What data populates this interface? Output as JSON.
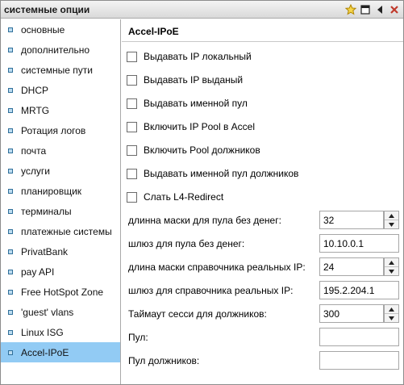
{
  "window": {
    "title": "системные опции"
  },
  "sidebar": {
    "items": [
      {
        "label": "основные"
      },
      {
        "label": "дополнительно"
      },
      {
        "label": "системные пути"
      },
      {
        "label": "DHCP"
      },
      {
        "label": "MRTG"
      },
      {
        "label": "Ротация логов"
      },
      {
        "label": "почта"
      },
      {
        "label": "услуги"
      },
      {
        "label": "планировщик"
      },
      {
        "label": "терминалы"
      },
      {
        "label": "платежные системы"
      },
      {
        "label": "PrivatBank"
      },
      {
        "label": "pay API"
      },
      {
        "label": "Free HotSpot Zone"
      },
      {
        "label": "'guest' vlans"
      },
      {
        "label": "Linux ISG"
      },
      {
        "label": "Accel-IPoE"
      }
    ],
    "active_index": 16
  },
  "main": {
    "heading": "Accel-IPoE",
    "checkboxes": [
      {
        "label": "Выдавать IP локальный",
        "checked": false
      },
      {
        "label": "Выдавать IP выданый",
        "checked": false
      },
      {
        "label": "Выдавать именной пул",
        "checked": false
      },
      {
        "label": "Включить IP Pool в Accel",
        "checked": false
      },
      {
        "label": "Включить Pool должников",
        "checked": false
      },
      {
        "label": "Выдавать именной пул должников",
        "checked": false
      },
      {
        "label": "Слать L4-Redirect",
        "checked": false
      }
    ],
    "fields": [
      {
        "label": "длинна маски для пула без денег:",
        "value": "32",
        "spinner": true
      },
      {
        "label": "шлюз для пула без денег:",
        "value": "10.10.0.1",
        "spinner": false
      },
      {
        "label": "длина маски справочника реальных IP:",
        "value": "24",
        "spinner": true
      },
      {
        "label": "шлюз для справочника реальных IP:",
        "value": "195.2.204.1",
        "spinner": false
      },
      {
        "label": "Таймаут сесси для должников:",
        "value": "300",
        "spinner": true
      },
      {
        "label": "Пул:",
        "value": "",
        "spinner": false
      },
      {
        "label": "Пул должников:",
        "value": "",
        "spinner": false
      }
    ]
  },
  "icons": {
    "titlebar": [
      "star-icon",
      "maximize-icon",
      "collapse-left-icon",
      "close-icon"
    ],
    "star_color": "#f2c200",
    "close_color": "#c0392b"
  }
}
